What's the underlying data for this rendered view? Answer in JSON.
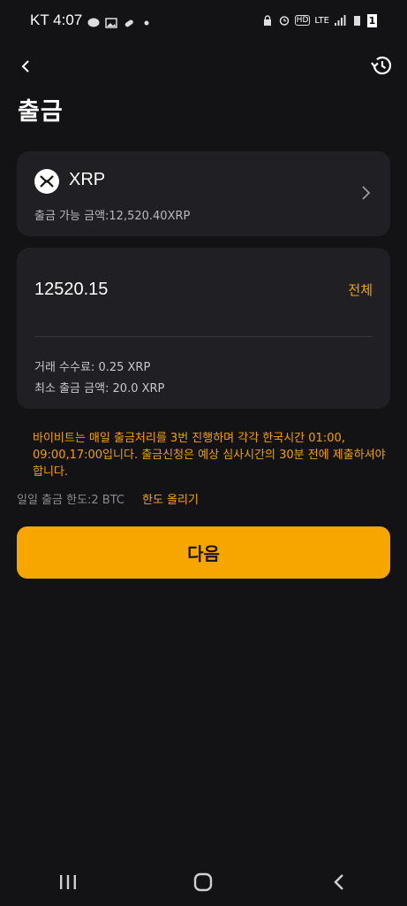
{
  "status_bar": {
    "carrier_time": "KT 4:07",
    "network": "LTE",
    "hd": "HD",
    "battery_badge": "1"
  },
  "header": {
    "title": "출금"
  },
  "coin": {
    "name": "XRP",
    "available": "출금 가능 금액:12,520.40XRP"
  },
  "amount": {
    "value": "12520.15",
    "max_label": "전체",
    "fee": "거래 수수료: 0.25 XRP",
    "min_withdraw": "최소 출금 금액: 20.0 XRP"
  },
  "notice": "바이비트는 매일 출금처리를 3번 진행하며 각각 한국시간 01:00, 09:00,17:00입니다. 출금신청은 예상 심사시간의 30분 전에 제출하셔야 합니다.",
  "limit": {
    "label": "일일 출금 한도:2 BTC",
    "raise": "한도 올리기"
  },
  "next_button": "다음",
  "colors": {
    "background": "#131316",
    "card": "#1f1f24",
    "accent": "#f7a600"
  }
}
